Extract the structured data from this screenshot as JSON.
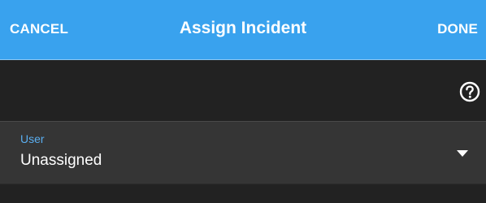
{
  "header": {
    "cancel_label": "CANCEL",
    "title": "Assign Incident",
    "done_label": "DONE"
  },
  "toolbar": {
    "help_icon": "help-circle-icon"
  },
  "form": {
    "user_field": {
      "label": "User",
      "value": "Unassigned",
      "dropdown_icon": "caret-down-icon"
    }
  },
  "colors": {
    "header_bg": "#39a2ee",
    "page_bg": "#222222",
    "field_bg": "#353535",
    "label_accent": "#5aaef0",
    "text": "#ffffff"
  }
}
